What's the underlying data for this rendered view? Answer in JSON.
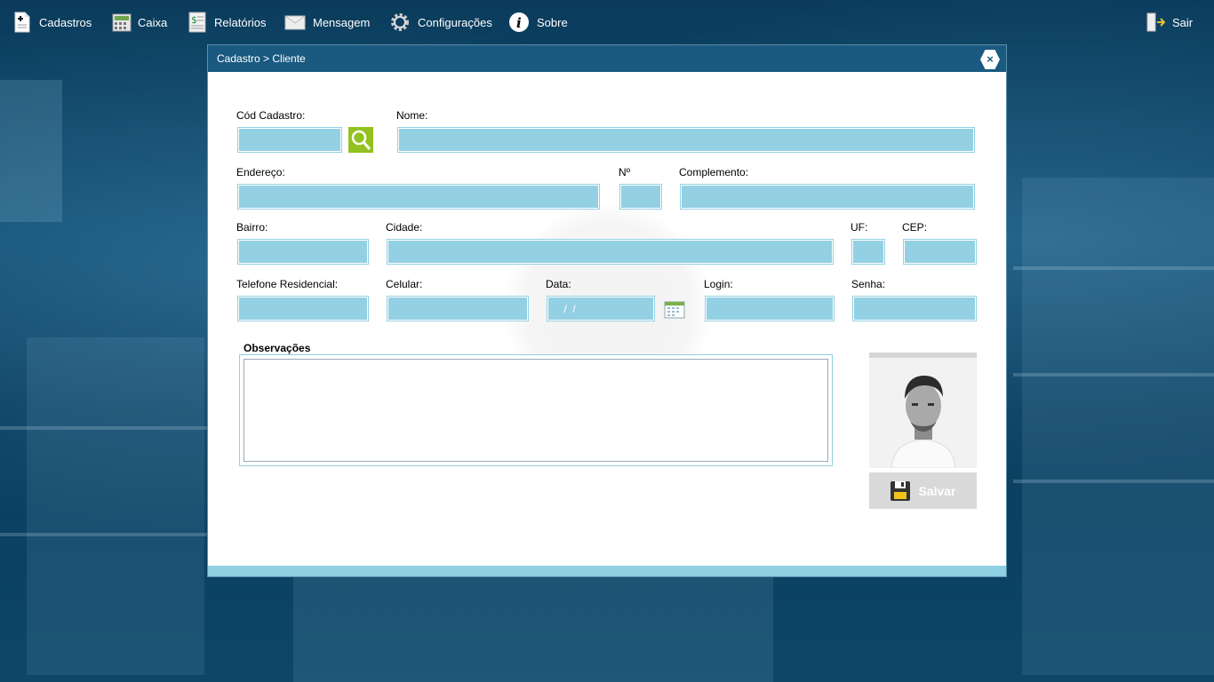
{
  "menu": {
    "items": [
      {
        "label": "Cadastros",
        "icon": "document-icon"
      },
      {
        "label": "Caixa",
        "icon": "cash-register-icon"
      },
      {
        "label": "Relatórios",
        "icon": "report-icon"
      },
      {
        "label": "Mensagem",
        "icon": "envelope-icon"
      },
      {
        "label": "Configurações",
        "icon": "gear-icon"
      },
      {
        "label": "Sobre",
        "icon": "info-icon"
      }
    ],
    "exit_label": "Sair"
  },
  "dialog": {
    "breadcrumb": "Cadastro > Cliente",
    "close_symbol": "×"
  },
  "form": {
    "cod_label": "Cód Cadastro:",
    "nome_label": "Nome:",
    "endereco_label": "Endereço:",
    "numero_label": "Nº",
    "complemento_label": "Complemento:",
    "bairro_label": "Bairro:",
    "cidade_label": "Cidade:",
    "uf_label": "UF:",
    "cep_label": "CEP:",
    "telefone_label": "Telefone Residencial:",
    "celular_label": "Celular:",
    "data_label": "Data:",
    "data_value": " /  /",
    "login_label": "Login:",
    "senha_label": "Senha:",
    "observacoes_label": "Observações"
  },
  "save_label": "Salvar",
  "colors": {
    "header": "#1a5a80",
    "field": "#94d0e3",
    "search_button": "#93c11f",
    "save_button": "#d9d9d9"
  }
}
